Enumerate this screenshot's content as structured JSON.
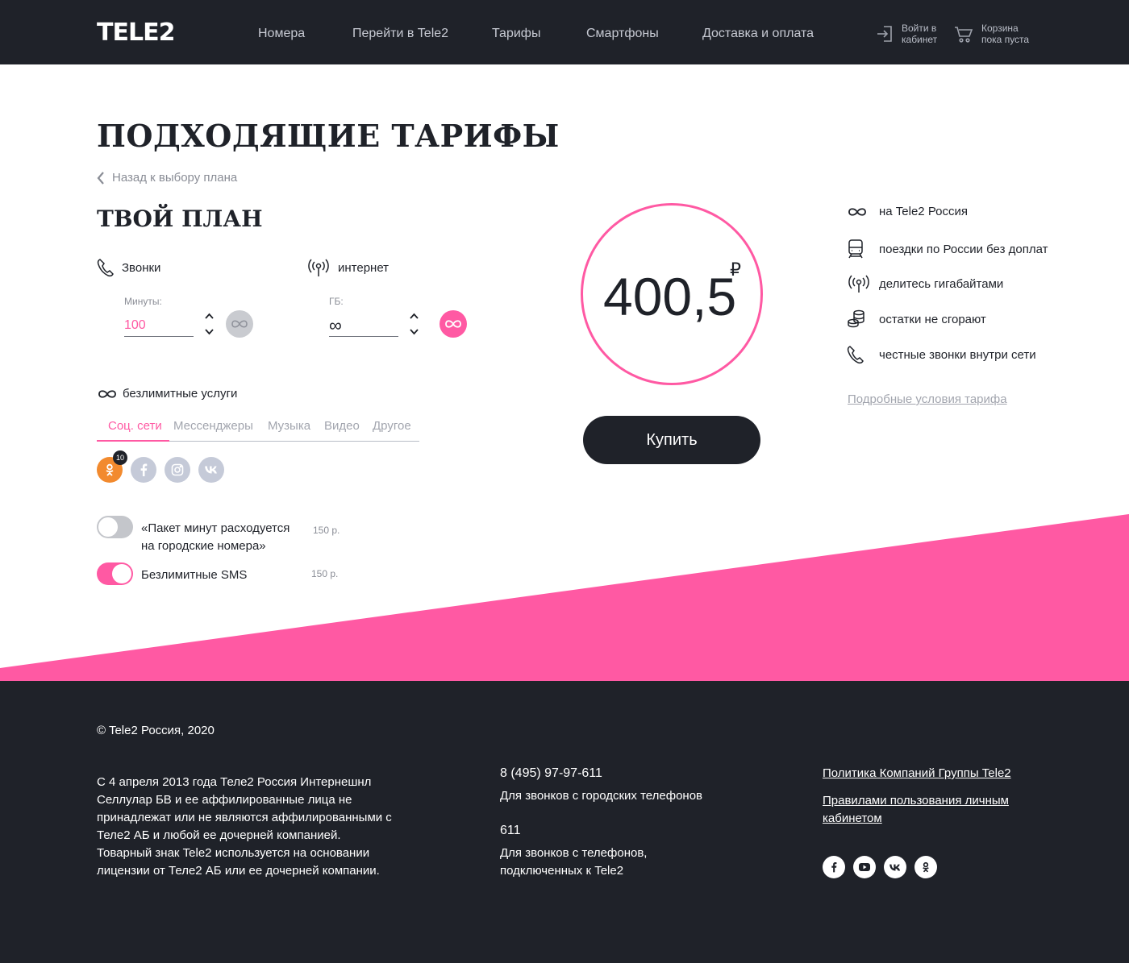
{
  "header": {
    "logo": "TELE2",
    "nav": [
      "Номера",
      "Перейти в Tele2",
      "Тарифы",
      "Смартфоны",
      "Доставка и оплата"
    ],
    "login_line1": "Войти в",
    "login_line2": "кабинет",
    "cart_line1": "Корзина",
    "cart_line2": "пока пуста"
  },
  "main": {
    "title": "ПОДХОДЯЩИЕ ТАРИФЫ",
    "back": "Назад к выбору плана",
    "plan_title": "ТВОЙ ПЛАН",
    "calls": {
      "label": "Звонки",
      "field_label": "Минуты:",
      "value": "100"
    },
    "internet": {
      "label": "интернет",
      "field_label": "ГБ:",
      "value": "∞"
    },
    "unlimited_label": "безлимитные услуги",
    "tabs": [
      "Соц. сети",
      "Мессенджеры",
      "Музыка",
      "Видео",
      "Другое"
    ],
    "active_tab": 0,
    "social_badge": "10",
    "social_icons": [
      "odnoklassniki-icon",
      "facebook-icon",
      "instagram-icon",
      "vk-icon"
    ],
    "options": [
      {
        "line1": "«Пакет минут расходуется",
        "line2": "на городские номера»",
        "price": "150 р.",
        "enabled": false
      },
      {
        "line1": "Безлимитные SMS",
        "line2": "",
        "price": "150 р.",
        "enabled": true
      }
    ]
  },
  "price": {
    "value": "400,5",
    "currency": "₽",
    "buy_label": "Купить"
  },
  "features": [
    "на Tele2 Россия",
    "поездки по России без доплат",
    "делитесь гигабайтами",
    "остатки не сгорают",
    "честные звонки внутри сети"
  ],
  "details_link": "Подробные условия тарифа",
  "footer": {
    "copyright": "© Tele2 Россия, 2020",
    "legal": "С 4 апреля 2013 года Теле2 Россия Интернешнл Селлулар БВ и ее аффилированные лица не принадлежат или не являются аффилированными с Теле2 АБ и любой ее дочерней компанией. Товарный знак Tele2 используется на основании лицензии от Теле2 АБ или ее дочерней компании.",
    "phone1": "8 (495) 97-97-611",
    "phone1_desc": "Для звонков с городских телефонов",
    "phone2": "611",
    "phone2_desc_line1": "Для звонков с телефонов,",
    "phone2_desc_line2": "подключенных к Tele2",
    "link1": "Политика Компаний Группы Tele2",
    "link2_line1": "Правилами пользования личным",
    "link2_line2": "кабинетом",
    "social": [
      "facebook-icon",
      "youtube-icon",
      "vk-icon",
      "odnoklassniki-icon"
    ]
  },
  "colors": {
    "dark": "#1f2229",
    "pink": "#ff59a3",
    "orange": "#f28a2e",
    "muted": "#c5cad8"
  }
}
